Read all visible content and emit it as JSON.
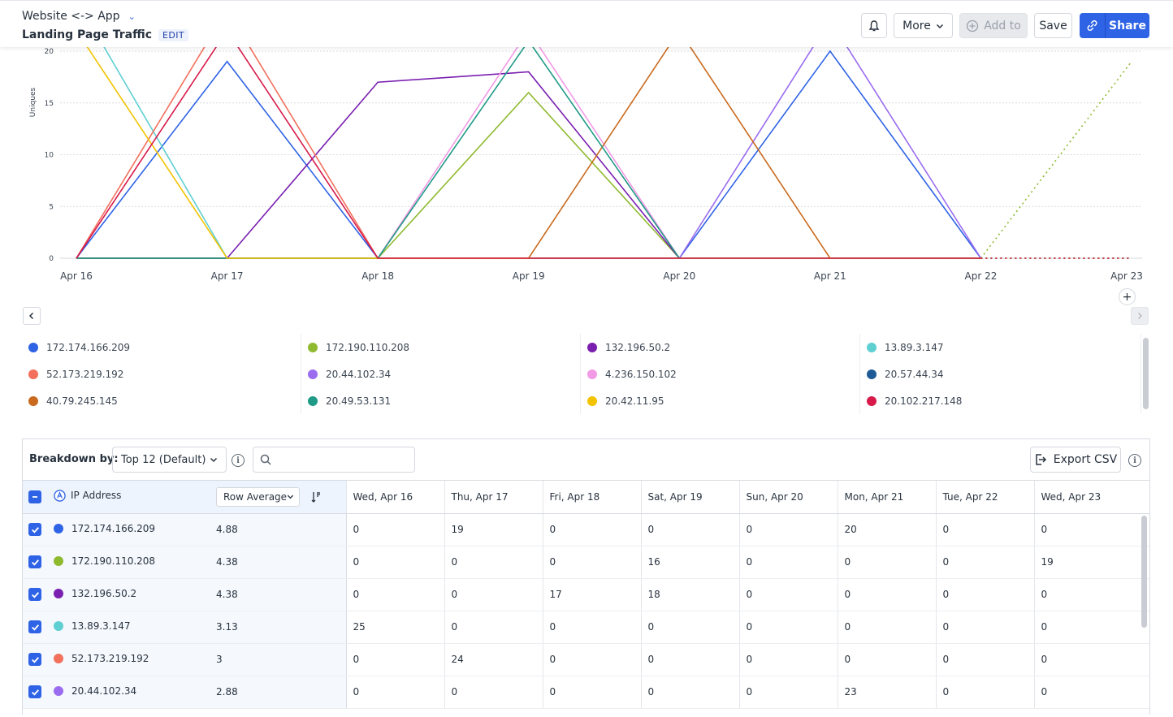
{
  "header": {
    "breadcrumb": "Website <-> App",
    "title": "Landing Page Traffic",
    "edit_label": "EDIT",
    "more_label": "More",
    "add_to_label": "Add to",
    "save_label": "Save",
    "share_label": "Share"
  },
  "chart_data": {
    "type": "line",
    "ylabel": "Uniques",
    "y_ticks": [
      "0",
      "5",
      "10",
      "15",
      "20"
    ],
    "ylim": [
      0,
      20
    ],
    "x": [
      "Apr 16",
      "Apr 17",
      "Apr 18",
      "Apr 19",
      "Apr 20",
      "Apr 21",
      "Apr 22",
      "Apr 23"
    ],
    "grid": true,
    "series": [
      {
        "name": "172.174.166.209",
        "color": "#2f63e6",
        "values": [
          0,
          19,
          0,
          0,
          0,
          20,
          0,
          0
        ]
      },
      {
        "name": "172.190.110.208",
        "color": "#8fba30",
        "values": [
          0,
          0,
          0,
          16,
          0,
          0,
          0,
          19
        ]
      },
      {
        "name": "132.196.50.2",
        "color": "#7a1fb0",
        "values": [
          0,
          0,
          17,
          18,
          0,
          0,
          0,
          0
        ]
      },
      {
        "name": "13.89.3.147",
        "color": "#5fcfd2",
        "values": [
          25,
          0,
          0,
          0,
          0,
          0,
          0,
          0
        ]
      },
      {
        "name": "52.173.219.192",
        "color": "#f2705c",
        "values": [
          0,
          24,
          0,
          0,
          0,
          0,
          0,
          0
        ]
      },
      {
        "name": "20.44.102.34",
        "color": "#9b6cf0",
        "values": [
          0,
          0,
          0,
          0,
          0,
          23,
          0,
          0
        ]
      },
      {
        "name": "4.236.150.102",
        "color": "#f29ae6",
        "values": [
          0,
          0,
          0,
          22,
          0,
          0,
          0,
          0
        ]
      },
      {
        "name": "20.57.44.34",
        "color": "#1e5b96",
        "values": [
          0,
          0,
          0,
          0,
          0,
          0,
          0,
          0
        ]
      },
      {
        "name": "40.79.245.145",
        "color": "#c96a1e",
        "values": [
          0,
          0,
          0,
          0,
          22,
          0,
          0,
          0
        ]
      },
      {
        "name": "20.49.53.131",
        "color": "#1f9a86",
        "values": [
          0,
          0,
          0,
          21,
          0,
          0,
          0,
          0
        ]
      },
      {
        "name": "20.42.11.95",
        "color": "#f3c300",
        "values": [
          22,
          0,
          0,
          0,
          0,
          0,
          0,
          0
        ]
      },
      {
        "name": "20.102.217.148",
        "color": "#d81a4a",
        "values": [
          0,
          22,
          0,
          0,
          0,
          0,
          0,
          0
        ]
      }
    ]
  },
  "legend": [
    {
      "label": "172.174.166.209",
      "color": "#2f63e6"
    },
    {
      "label": "172.190.110.208",
      "color": "#8fba30"
    },
    {
      "label": "132.196.50.2",
      "color": "#7a1fb0"
    },
    {
      "label": "13.89.3.147",
      "color": "#5fcfd2"
    },
    {
      "label": "52.173.219.192",
      "color": "#f2705c"
    },
    {
      "label": "20.44.102.34",
      "color": "#9b6cf0"
    },
    {
      "label": "4.236.150.102",
      "color": "#f29ae6"
    },
    {
      "label": "20.57.44.34",
      "color": "#1e5b96"
    },
    {
      "label": "40.79.245.145",
      "color": "#c96a1e"
    },
    {
      "label": "20.49.53.131",
      "color": "#1f9a86"
    },
    {
      "label": "20.42.11.95",
      "color": "#f3c300"
    },
    {
      "label": "20.102.217.148",
      "color": "#d81a4a"
    }
  ],
  "breakdown": {
    "label": "Breakdown by:",
    "selected": "Top 12 (Default)",
    "search_placeholder": "",
    "export_label": "Export CSV"
  },
  "table": {
    "col_property": "IP Address",
    "col_metric": "Row Average",
    "days": [
      "Wed, Apr 16",
      "Thu, Apr 17",
      "Fri, Apr 18",
      "Sat, Apr 19",
      "Sun, Apr 20",
      "Mon, Apr 21",
      "Tue, Apr 22",
      "Wed, Apr 23"
    ],
    "rows": [
      {
        "ip": "172.174.166.209",
        "color": "#2f63e6",
        "avg": "4.88",
        "values": [
          "0",
          "19",
          "0",
          "0",
          "0",
          "20",
          "0",
          "0"
        ]
      },
      {
        "ip": "172.190.110.208",
        "color": "#8fba30",
        "avg": "4.38",
        "values": [
          "0",
          "0",
          "0",
          "16",
          "0",
          "0",
          "0",
          "19"
        ]
      },
      {
        "ip": "132.196.50.2",
        "color": "#7a1fb0",
        "avg": "4.38",
        "values": [
          "0",
          "0",
          "17",
          "18",
          "0",
          "0",
          "0",
          "0"
        ]
      },
      {
        "ip": "13.89.3.147",
        "color": "#5fcfd2",
        "avg": "3.13",
        "values": [
          "25",
          "0",
          "0",
          "0",
          "0",
          "0",
          "0",
          "0"
        ]
      },
      {
        "ip": "52.173.219.192",
        "color": "#f2705c",
        "avg": "3",
        "values": [
          "0",
          "24",
          "0",
          "0",
          "0",
          "0",
          "0",
          "0"
        ]
      },
      {
        "ip": "20.44.102.34",
        "color": "#9b6cf0",
        "avg": "2.88",
        "values": [
          "0",
          "0",
          "0",
          "0",
          "0",
          "23",
          "0",
          "0"
        ]
      }
    ]
  }
}
